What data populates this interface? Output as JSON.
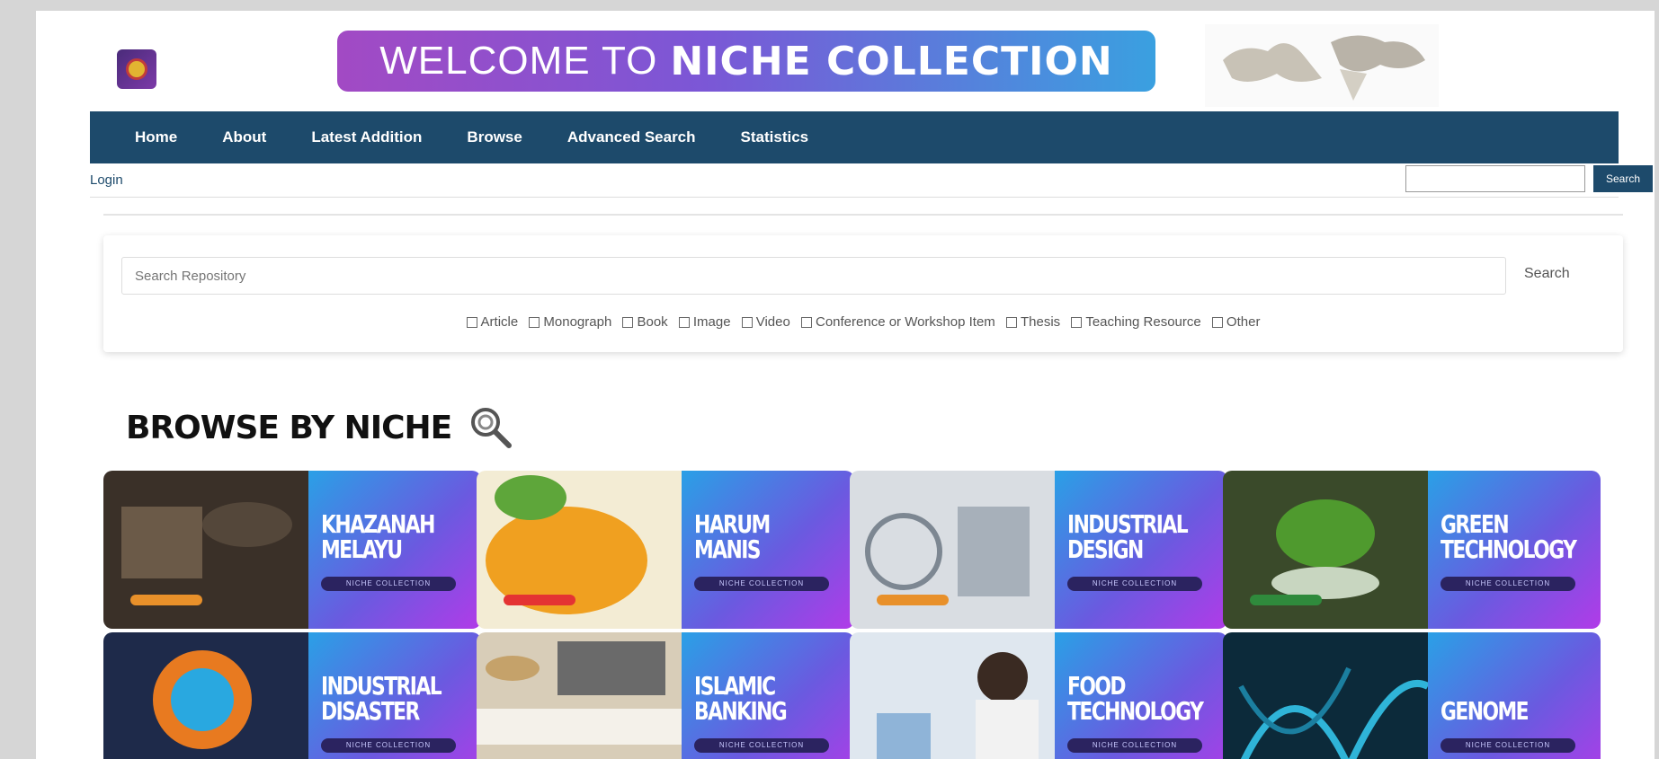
{
  "header": {
    "banner_light": "WELCOME TO",
    "banner_bold": "NICHE COLLECTION"
  },
  "nav": {
    "items": [
      "Home",
      "About",
      "Latest Addition",
      "Browse",
      "Advanced Search",
      "Statistics"
    ]
  },
  "login": {
    "link": "Login",
    "search_button": "Search"
  },
  "search": {
    "placeholder": "Search Repository",
    "button": "Search",
    "filters": [
      "Article",
      "Monograph",
      "Book",
      "Image",
      "Video",
      "Conference or Workshop Item",
      "Thesis",
      "Teaching Resource",
      "Other"
    ]
  },
  "browse": {
    "title": "BROWSE BY NICHE",
    "badge": "NICHE COLLECTION",
    "tiles": [
      {
        "line1": "KHAZANAH",
        "line2": "MELAYU"
      },
      {
        "line1": "HARUM",
        "line2": "MANIS"
      },
      {
        "line1": "INDUSTRIAL",
        "line2": "DESIGN"
      },
      {
        "line1": "GREEN",
        "line2": "TECHNOLOGY"
      },
      {
        "line1": "INDUSTRIAL",
        "line2": "DISASTER"
      },
      {
        "line1": "ISLAMIC",
        "line2": "BANKING"
      },
      {
        "line1": "FOOD",
        "line2": "TECHNOLOGY"
      },
      {
        "line1": "",
        "line2": "GENOME"
      }
    ]
  },
  "colors": {
    "nav": "#1d4a6b",
    "panel_from": "#2aa0e6",
    "panel_to": "#b13be8"
  }
}
